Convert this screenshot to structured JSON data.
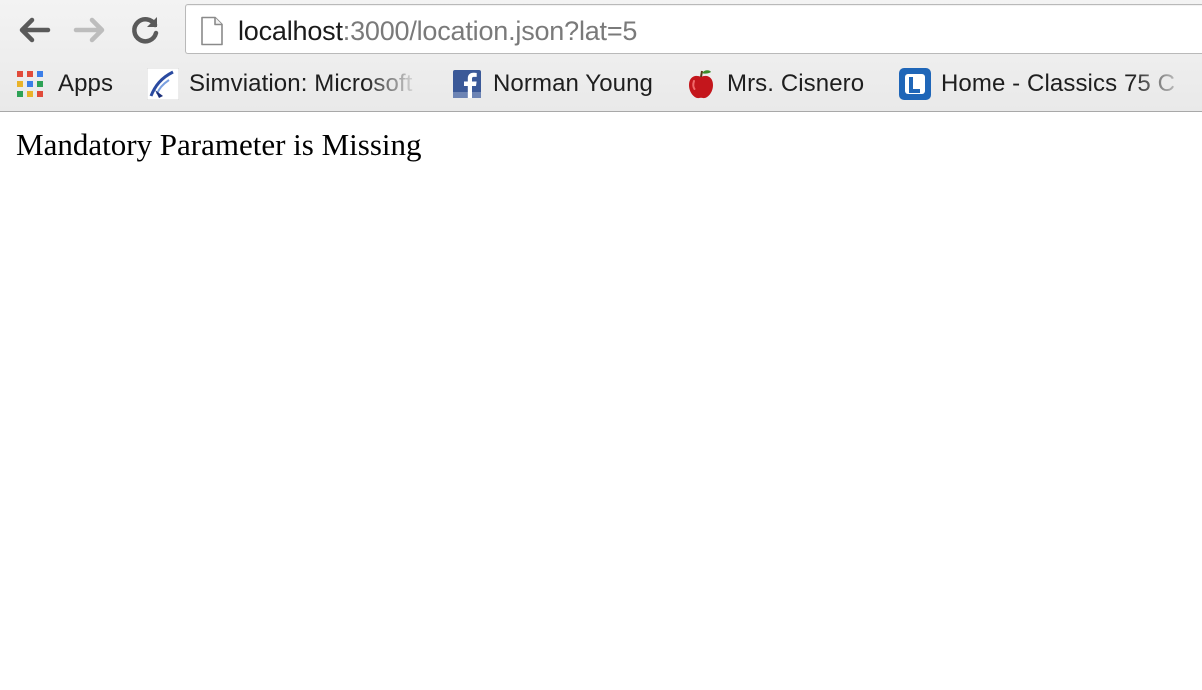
{
  "toolbar": {
    "back_icon": "back-arrow-icon",
    "forward_icon": "forward-arrow-icon",
    "reload_icon": "reload-icon"
  },
  "omnibox": {
    "url_host": "localhost",
    "url_path": ":3000/location.json?lat=5",
    "page_icon": "document-icon"
  },
  "bookmarks": [
    {
      "label": "Apps",
      "icon": "apps-grid-icon"
    },
    {
      "label": "Simviation: Microsoft",
      "icon": "simviation-icon"
    },
    {
      "label": "Norman Young",
      "icon": "facebook-icon"
    },
    {
      "label": "Mrs. Cisnero",
      "icon": "apple-icon"
    },
    {
      "label": "Home - Classics 75 C",
      "icon": "l-logo-icon"
    }
  ],
  "page": {
    "message": "Mandatory Parameter is Missing"
  },
  "colors": {
    "toolbar_bg": "#efefef",
    "url_host": "#1a1a1a",
    "url_path": "#7a7a7a",
    "facebook_blue": "#3b5998"
  }
}
